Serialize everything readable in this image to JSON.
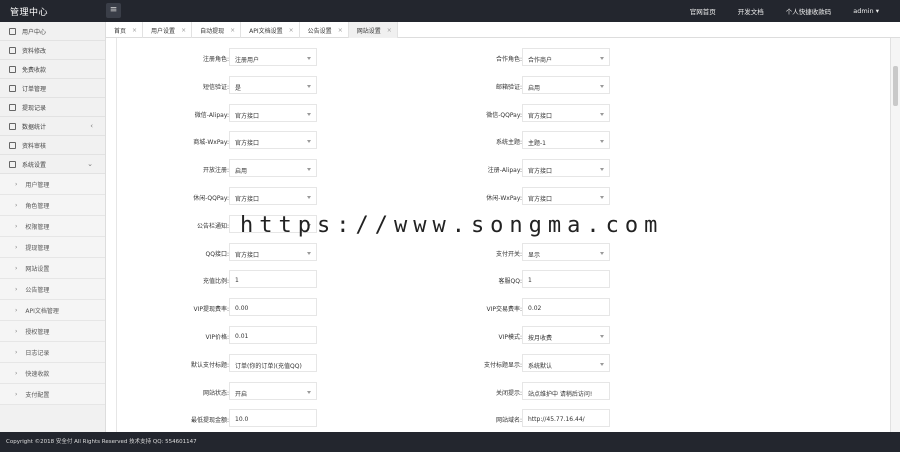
{
  "header": {
    "brand": "管理中心",
    "toggle_icon": "menu-icon",
    "nav": [
      "官网首页",
      "开发文档",
      "个人快捷收款码",
      "admin ▾"
    ]
  },
  "sidebar": {
    "items": [
      {
        "label": "用户中心"
      },
      {
        "label": "资料修改"
      },
      {
        "label": "免费收款"
      },
      {
        "label": "订单管理"
      },
      {
        "label": "提现记录"
      },
      {
        "label": "数据统计",
        "caret": "‹"
      },
      {
        "label": "资料审核"
      },
      {
        "label": "系统设置",
        "caret": "⌄"
      }
    ],
    "subitems": [
      "用户管理",
      "角色管理",
      "权限管理",
      "提现管理",
      "网站设置",
      "公告管理",
      "API文档管理",
      "授权管理",
      "日志记录",
      "快速收款",
      "支付配置"
    ]
  },
  "tabs": [
    {
      "label": "首页",
      "closable": true
    },
    {
      "label": "用户设置",
      "closable": true
    },
    {
      "label": "自动提现",
      "closable": true
    },
    {
      "label": "API文档设置",
      "closable": true
    },
    {
      "label": "公告设置",
      "closable": true
    },
    {
      "label": "网站设置",
      "closable": true,
      "active": true
    }
  ],
  "form": {
    "left": [
      {
        "label": "注册角色:",
        "value": "注册用户",
        "type": "select"
      },
      {
        "label": "短信验证:",
        "value": "是",
        "type": "select"
      },
      {
        "label": "微信-Alipay:",
        "value": "官方接口",
        "type": "select"
      },
      {
        "label": "商城-WxPay:",
        "value": "官方接口",
        "type": "select"
      },
      {
        "label": "开放注册:",
        "value": "启用",
        "type": "select"
      },
      {
        "label": "休闲-QQPay:",
        "value": "官方接口",
        "type": "select"
      },
      {
        "label": "公告栏通知:",
        "value": "",
        "type": "select"
      },
      {
        "label": "QQ接口:",
        "value": "官方接口",
        "type": "select"
      },
      {
        "label": "充值比例:",
        "value": "1",
        "type": "text"
      },
      {
        "label": "VIP提现费率:",
        "value": "0.00",
        "type": "text"
      },
      {
        "label": "VIP价格:",
        "value": "0.01",
        "type": "text"
      },
      {
        "label": "默认支付标题:",
        "value": "订单(你的订单)(充值QQ)",
        "type": "text"
      },
      {
        "label": "网站状态:",
        "value": "开启",
        "type": "select"
      },
      {
        "label": "最低提现金额:",
        "value": "10.0",
        "type": "text"
      }
    ],
    "right": [
      {
        "label": "合作角色:",
        "value": "合作商户",
        "type": "select"
      },
      {
        "label": "邮箱验证:",
        "value": "启用",
        "type": "select"
      },
      {
        "label": "微信-QQPay:",
        "value": "官方接口",
        "type": "select"
      },
      {
        "label": "系统主题:",
        "value": "主题-1",
        "type": "select"
      },
      {
        "label": "注册-Alipay:",
        "value": "官方接口",
        "type": "select"
      },
      {
        "label": "休闲-WxPay:",
        "value": "官方接口",
        "type": "select"
      },
      {
        "label": "",
        "value": "",
        "type": "none"
      },
      {
        "label": "支付开关:",
        "value": "显示",
        "type": "select"
      },
      {
        "label": "客服QQ:",
        "value": "1",
        "type": "text"
      },
      {
        "label": "VIP交易费率:",
        "value": "0.02",
        "type": "text"
      },
      {
        "label": "VIP模式:",
        "value": "按月收费",
        "type": "select"
      },
      {
        "label": "支付标题显示:",
        "value": "系统默认",
        "type": "select"
      },
      {
        "label": "关闭提示:",
        "value": "站点维护中 请稍后访问!",
        "type": "text"
      },
      {
        "label": "网站域名:",
        "value": "http://45.77.16.44/",
        "type": "text"
      }
    ]
  },
  "watermark": "https://www.songma.com",
  "footer": "Copyright ©2018 安全付 All Rights Reserved   技术支持 QQ: 554601147"
}
